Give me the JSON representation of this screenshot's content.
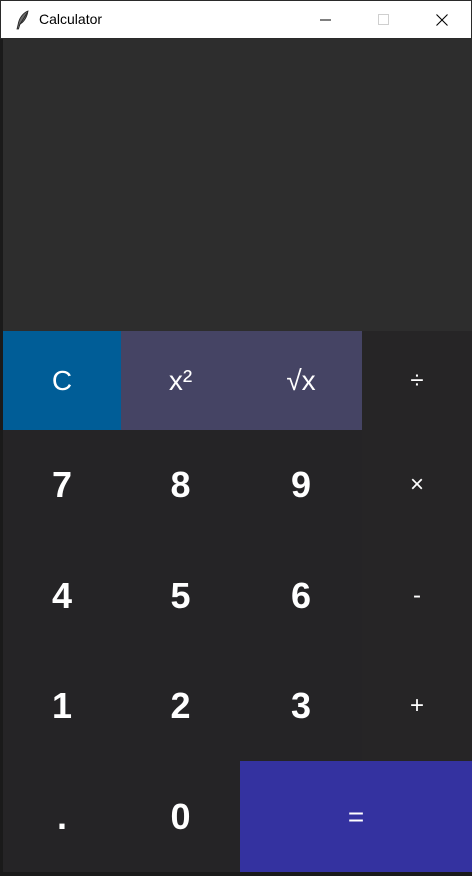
{
  "window": {
    "title": "Calculator",
    "icon": "feather-icon",
    "controls": {
      "minimize_icon": "minimize-icon",
      "maximize_icon": "maximize-icon",
      "close_icon": "close-icon"
    }
  },
  "display": {
    "value": ""
  },
  "keys": {
    "clear": "C",
    "square": "x²",
    "sqrt": "√x",
    "divide": "÷",
    "seven": "7",
    "eight": "8",
    "nine": "9",
    "multiply": "×",
    "four": "4",
    "five": "5",
    "six": "6",
    "minus": "-",
    "one": "1",
    "two": "2",
    "three": "3",
    "plus": "+",
    "decimal": ".",
    "zero": "0",
    "equals": "="
  },
  "colors": {
    "clear": "#005d97",
    "function": "#454464",
    "equals": "#3432a0",
    "digit_bg": "#252426",
    "display_bg": "#2d2d2d"
  }
}
